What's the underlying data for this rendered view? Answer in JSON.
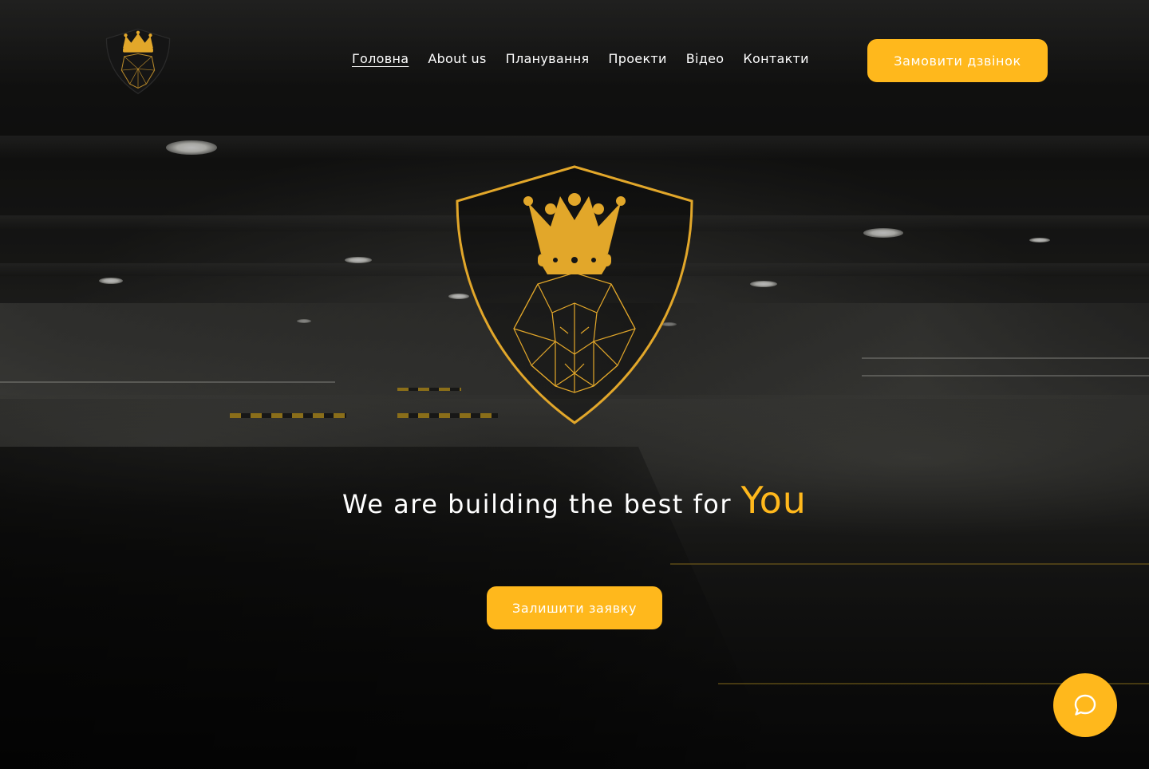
{
  "nav": {
    "items": [
      {
        "label": "Головна",
        "active": true
      },
      {
        "label": "About us",
        "active": false
      },
      {
        "label": "Планування",
        "active": false
      },
      {
        "label": "Проекти",
        "active": false
      },
      {
        "label": "Відео",
        "active": false
      },
      {
        "label": "Контакти",
        "active": false
      }
    ]
  },
  "header": {
    "call_button_label": "Замовити дзвінок",
    "logo_icon": "crown-lion-shield-icon"
  },
  "hero": {
    "tagline_main": "We are building the best for",
    "tagline_accent": "You",
    "request_button_label": "Залишити заявку",
    "emblem_icon": "crown-lion-shield-icon"
  },
  "chat": {
    "icon": "chat-bubble-icon"
  },
  "colors": {
    "accent": "#ffb81c",
    "text": "#ffffff",
    "background": "#0b0b0b"
  }
}
